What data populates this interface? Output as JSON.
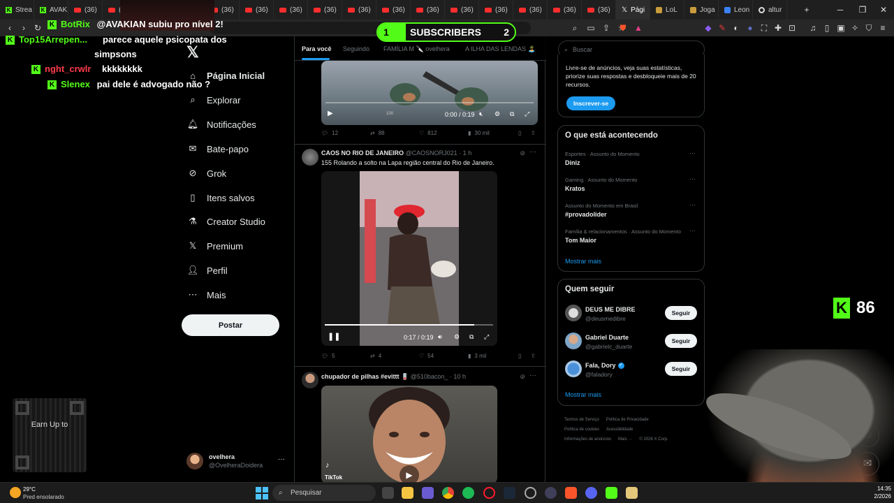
{
  "browser": {
    "tabs": [
      {
        "label": "Strea",
        "icon": "kick-icon"
      },
      {
        "label": "AVAKIAN",
        "icon": "kick-icon"
      },
      {
        "label": "(36)",
        "icon": "youtube-icon"
      },
      {
        "label": "(36)",
        "icon": "youtube-icon"
      },
      {
        "label": "(36)",
        "icon": "youtube-icon"
      },
      {
        "label": "(36)",
        "icon": "youtube-icon"
      },
      {
        "label": "(36)",
        "icon": "youtube-icon"
      },
      {
        "label": "(36)",
        "icon": "youtube-icon"
      },
      {
        "label": "(36)",
        "icon": "youtube-icon"
      },
      {
        "label": "(36)",
        "icon": "youtube-icon"
      },
      {
        "label": "(36)",
        "icon": "youtube-icon"
      },
      {
        "label": "(36)",
        "icon": "youtube-icon"
      },
      {
        "label": "(36)",
        "icon": "youtube-icon"
      },
      {
        "label": "(36)",
        "icon": "youtube-icon"
      },
      {
        "label": "(36)",
        "icon": "youtube-icon"
      },
      {
        "label": "(36)",
        "icon": "youtube-icon"
      },
      {
        "label": "(36)",
        "icon": "youtube-icon"
      },
      {
        "label": "(36)",
        "icon": "youtube-icon"
      },
      {
        "label": "Pági",
        "icon": "x-icon"
      },
      {
        "label": "LoL",
        "icon": "lol-icon"
      },
      {
        "label": "Joga",
        "icon": "lol-icon"
      },
      {
        "label": "Leon",
        "icon": "docs-icon"
      },
      {
        "label": "altur",
        "icon": "chrome-icon"
      }
    ],
    "new_tab": "+"
  },
  "stream": {
    "chat": [
      {
        "user": "BotRix",
        "color": "#53fc18",
        "msg": "@AVAKIAN subiu pro nível 2!"
      },
      {
        "user": "Top15Arrepen...",
        "color": "#53fc18",
        "msg": "parece aquele psicopata dos"
      },
      {
        "user": "",
        "color": "#53fc18",
        "msg": "simpsons"
      },
      {
        "user": "nght_crwlr",
        "color": "#ff3b4a",
        "msg": "kkkkkkkk"
      },
      {
        "user": "Slenex",
        "color": "#53fc18",
        "msg": "pai dele é advogado não ?"
      }
    ],
    "subs": {
      "left": "1",
      "label": "SUBSCRIBERS",
      "right": "2"
    },
    "viewers": "86",
    "qr_text": "Earn Up to"
  },
  "nav": {
    "items": [
      {
        "label": "Página Inicial",
        "icon": "home-icon"
      },
      {
        "label": "Explorar",
        "icon": "search-icon"
      },
      {
        "label": "Notificações",
        "icon": "bell-icon"
      },
      {
        "label": "Bate-papo",
        "icon": "mail-icon"
      },
      {
        "label": "Grok",
        "icon": "grok-icon"
      },
      {
        "label": "Itens salvos",
        "icon": "bookmark-icon"
      },
      {
        "label": "Creator Studio",
        "icon": "flask-icon"
      },
      {
        "label": "Premium",
        "icon": "x-logo-icon"
      },
      {
        "label": "Perfil",
        "icon": "user-icon"
      },
      {
        "label": "Mais",
        "icon": "more-circle-icon"
      }
    ],
    "post_label": "Postar",
    "account": {
      "name": "ovelhera",
      "handle": "@OvelheraDoidera",
      "more": "···"
    }
  },
  "feed": {
    "tabs": [
      "Para você",
      "Seguindo",
      "FAMÍLIA M 🔪 ovelhera",
      "A ILHA DAS LENDAS 🏝️"
    ],
    "tweet1": {
      "time": "0:00 / 0:19",
      "views_overlay": "100",
      "progress": 0,
      "replies": "12",
      "reposts": "88",
      "likes": "812",
      "views": "30 mil"
    },
    "tweet2": {
      "name": "CAOS NO RIO DE JANEIRO",
      "handle": "@CAOSNORJ021 · 1 h",
      "text": "155 Rolando a solto na Lapa região central do Rio de Janeiro.",
      "time": "0:17 / 0:19",
      "progress": 0.89,
      "replies": "5",
      "reposts": "4",
      "likes": "54",
      "views": "3 mil"
    },
    "tweet3": {
      "name": "chupador de pilhas #evittt 🪫",
      "handle": "@510bacon_ · 10 h",
      "watermark": "TikTok"
    }
  },
  "right": {
    "search_placeholder": "Buscar",
    "premium_text": "Livre-se de anúncios, veja suas estatísticas, priorize suas respostas e desbloqueie mais de 20 recursos.",
    "subscribe_label": "Inscrever-se",
    "trends_title": "O que está acontecendo",
    "trends": [
      {
        "meta": "Esportes · Assunto do Momento",
        "name": "Diniz"
      },
      {
        "meta": "Gaming · Assunto do Momento",
        "name": "Kratos"
      },
      {
        "meta": "Assunto do Momento em Brasil",
        "name": "#provadolider"
      },
      {
        "meta": "Família & relacionamentos · Assunto do Momento",
        "name": "Tom Maior"
      }
    ],
    "show_more": "Mostrar mais",
    "follow_title": "Quem seguir",
    "follow": [
      {
        "name": "DEUS ME DIBRE",
        "handle": "@deusmedibre",
        "btn": "Seguir"
      },
      {
        "name": "Gabriel Duarte",
        "handle": "@gabrielc_duarte",
        "btn": "Seguir"
      },
      {
        "name": "Fala, Dory",
        "handle": "@faladory",
        "btn": "Seguir",
        "verified": true
      }
    ],
    "follow_more": "Mostrar mais",
    "footer": [
      "Termos de Serviço",
      "Política de Privacidade",
      "Política de cookies",
      "Acessibilidade",
      "Informações de anúncios",
      "Mais ···",
      "© 2026 X Corp."
    ]
  },
  "taskbar": {
    "temp": "29°C",
    "weather": "Pred ensolarado",
    "search": "Pesquisar",
    "time": "14:35",
    "date": "2/2026"
  }
}
